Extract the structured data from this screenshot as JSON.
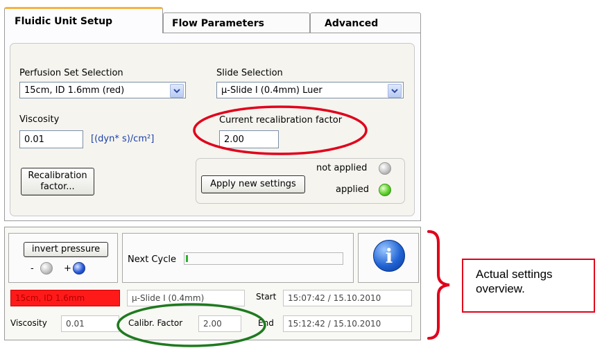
{
  "tabs": [
    {
      "label": "Fluidic Unit Setup"
    },
    {
      "label": "Flow Parameters"
    },
    {
      "label": "Advanced"
    }
  ],
  "setup": {
    "perfusion_label": "Perfusion Set Selection",
    "perfusion_value": "15cm, ID 1.6mm (red)",
    "slide_label": "Slide Selection",
    "slide_value": "µ-Slide I (0.4mm) Luer",
    "viscosity_label": "Viscosity",
    "viscosity_value": "0.01",
    "viscosity_unit": "[(dyn* s)/cm²]",
    "recal_label": "Current recalibration factor",
    "recal_value": "2.00",
    "recal_button_line1": "Recalibration",
    "recal_button_line2": "factor...",
    "apply_button": "Apply new settings",
    "not_applied_label": "not applied",
    "applied_label": "applied"
  },
  "overview": {
    "invert_button": "invert pressure",
    "minus_label": "-",
    "plus_label": "+",
    "next_cycle_label": "Next Cycle",
    "next_cycle_progress": 0.01,
    "info_icon": "i",
    "perfusion_set": "15cm, ID 1.6mm",
    "slide": "µ-Slide I (0.4mm)",
    "start_label": "Start",
    "start_value": "15:07:42 / 15.10.2010",
    "viscosity_label": "Viscosity",
    "viscosity_value": "0.01",
    "calibr_label": "Calibr. Factor",
    "calibr_value": "2.00",
    "end_label": "End",
    "end_value": "15:12:42 / 15.10.2010"
  },
  "callout": {
    "text_line1": "Actual settings",
    "text_line2": "overview."
  },
  "colors": {
    "red_highlight": "#e0001b",
    "green_highlight": "#1f7a1f",
    "perfusion_red_bg": "#ff1a1a",
    "tab_accent": "#f5b441"
  }
}
